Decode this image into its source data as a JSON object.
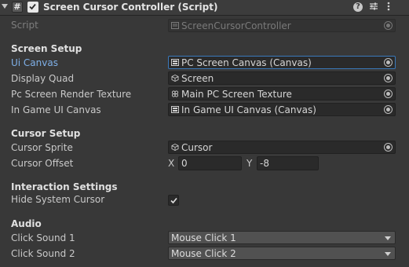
{
  "component": {
    "title": "Screen Cursor Controller (Script)",
    "header_icons": [
      "help-icon",
      "presets-icon",
      "more-icon"
    ]
  },
  "script_row": {
    "label": "Script",
    "value": "ScreenCursorController"
  },
  "screen_setup": {
    "heading": "Screen Setup",
    "fields": [
      {
        "label": "Ui Canvas",
        "value": "PC Screen Canvas (Canvas)",
        "icon": "canvas-icon"
      },
      {
        "label": "Display Quad",
        "value": "Screen",
        "icon": "gameobject-icon"
      },
      {
        "label": "Pc Screen Render Texture",
        "value": "Main PC Screen Texture",
        "icon": "render-texture-icon"
      },
      {
        "label": "In Game UI Canvas",
        "value": "In Game UI Canvas (Canvas)",
        "icon": "canvas-icon"
      }
    ]
  },
  "cursor_setup": {
    "heading": "Cursor Setup",
    "sprite_label": "Cursor Sprite",
    "sprite_value": "Cursor",
    "offset_label": "Cursor Offset",
    "x_label": "X",
    "x_value": "0",
    "y_label": "Y",
    "y_value": "-8"
  },
  "interaction": {
    "heading": "Interaction Settings",
    "hide_cursor_label": "Hide System Cursor",
    "hide_cursor_checked": true
  },
  "audio": {
    "heading": "Audio",
    "click1_label": "Click Sound 1",
    "click1_value": "Mouse Click 1",
    "click2_label": "Click Sound 2",
    "click2_value": "Mouse Click 2"
  },
  "colors": {
    "background": "#383838",
    "field": "#2a2a2a",
    "focus": "#3a79bb",
    "active_label": "#7fb0e8"
  }
}
